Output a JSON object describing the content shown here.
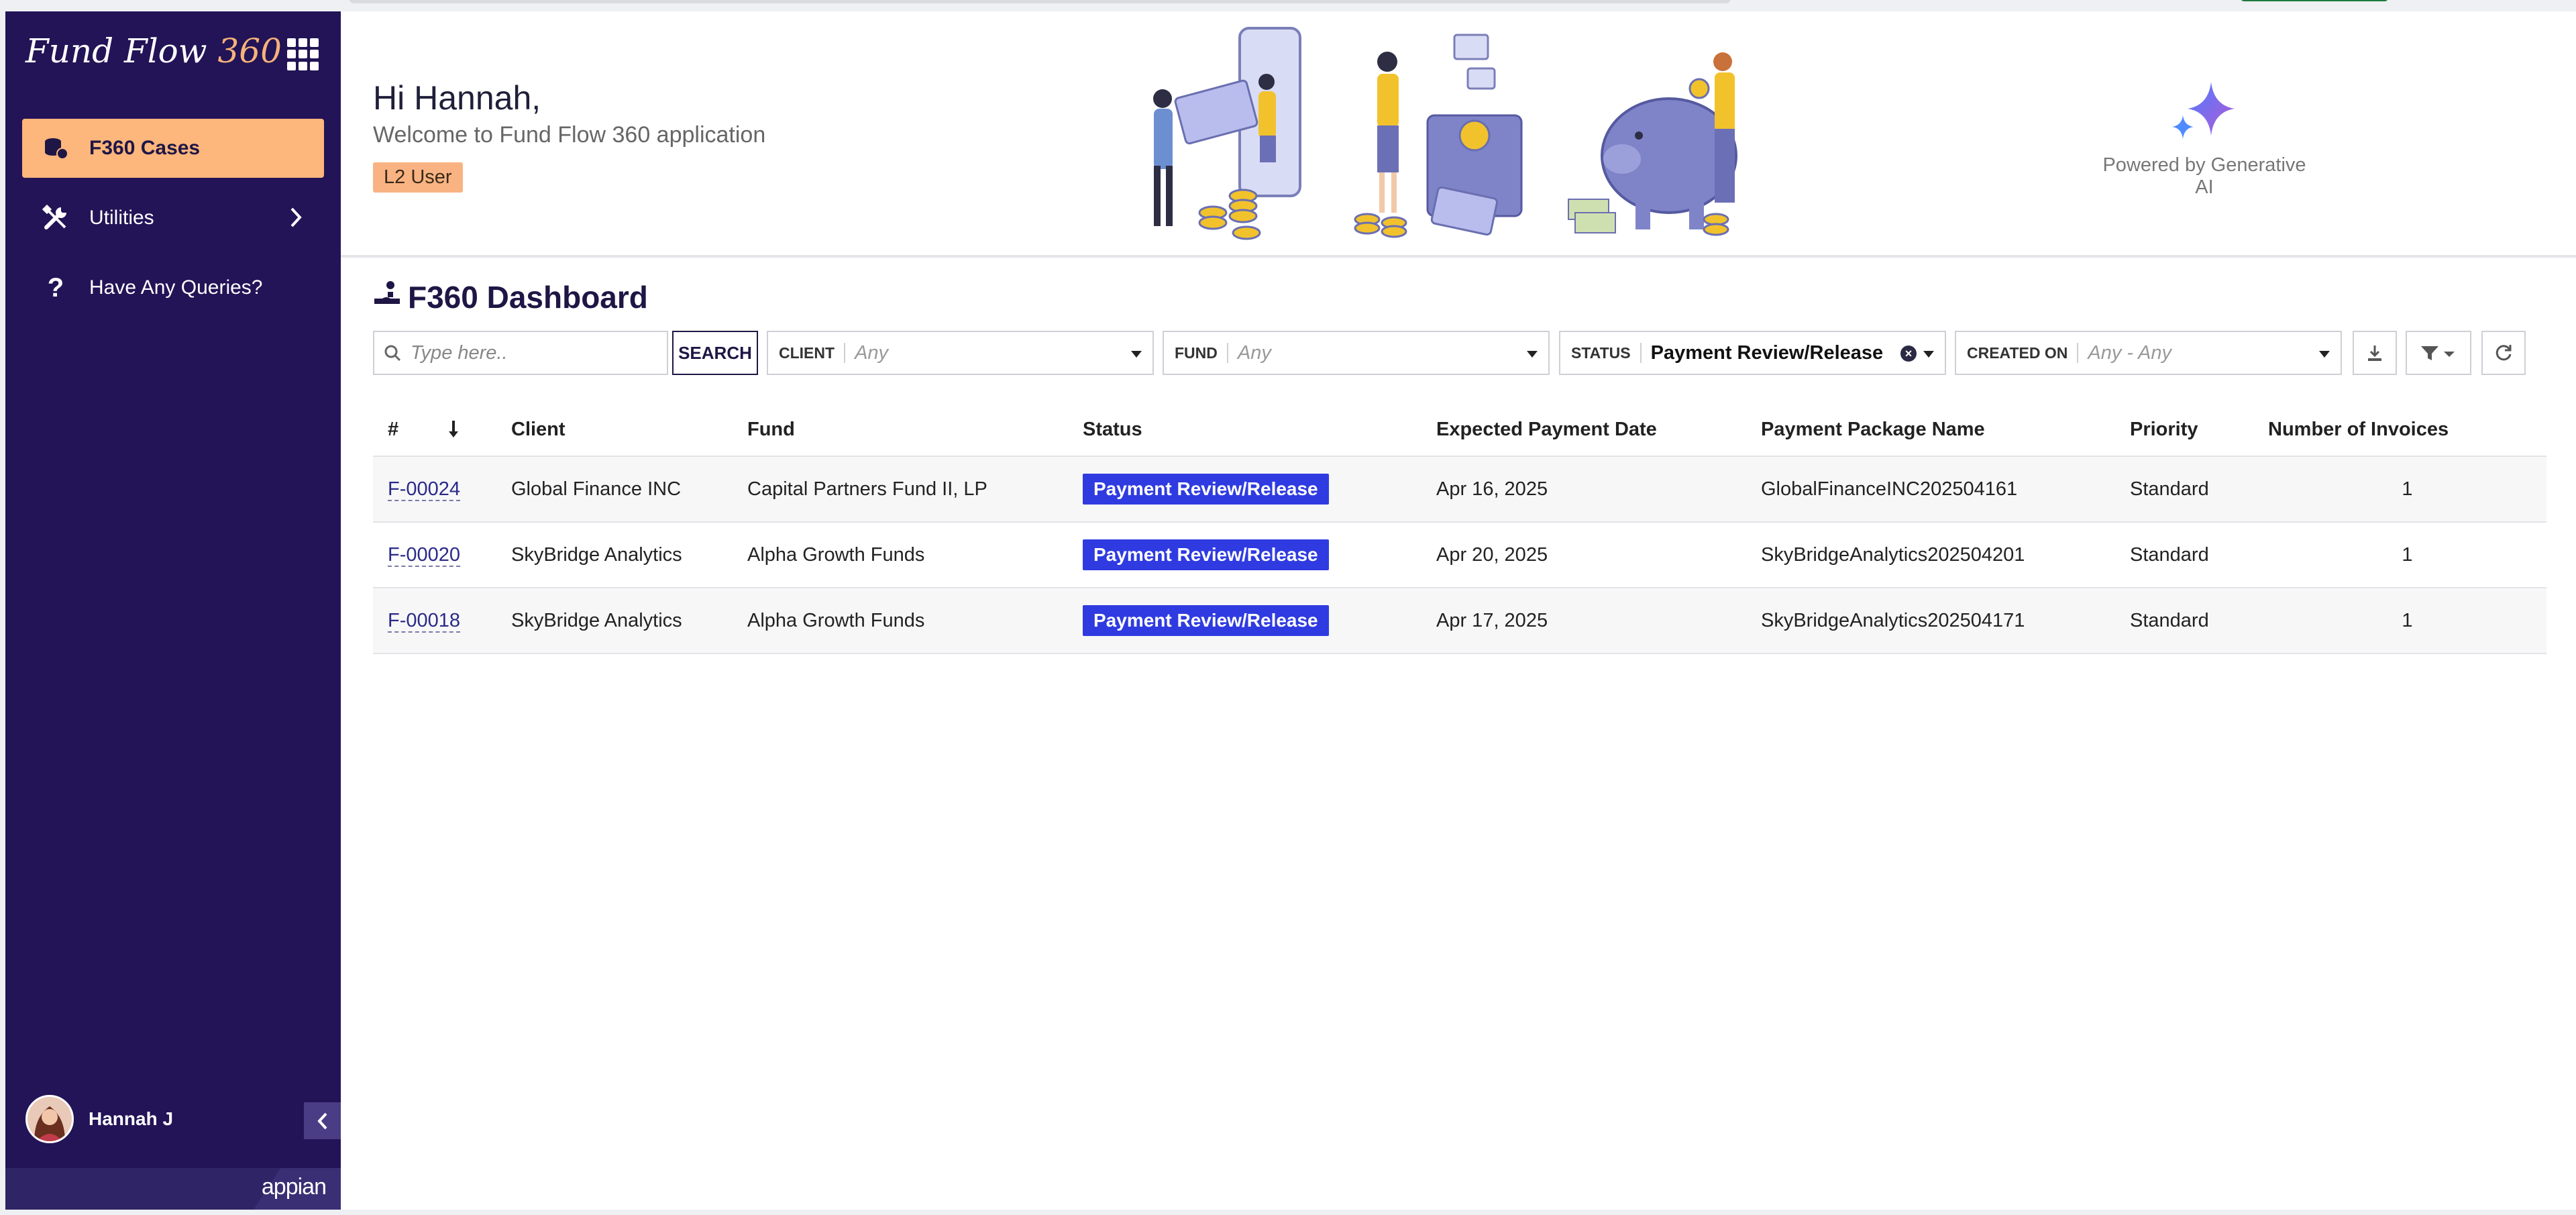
{
  "sidebar": {
    "brand_text": "Fund Flow",
    "brand_num": "360",
    "items": [
      {
        "label": "F360 Cases",
        "icon": "coins-stack-icon",
        "active": true
      },
      {
        "label": "Utilities",
        "icon": "tools-icon",
        "active": false
      },
      {
        "label": "Have Any Queries?",
        "icon": "question-icon",
        "active": false
      }
    ],
    "user_name": "Hannah J",
    "footer_brand": "appian"
  },
  "banner": {
    "greeting": "Hi Hannah,",
    "welcome": "Welcome to Fund Flow 360 application",
    "role": "L2 User",
    "powered_by": "Powered by Generative AI"
  },
  "dashboard": {
    "title": "F360 Dashboard",
    "search": {
      "placeholder": "Type here..",
      "button": "SEARCH"
    },
    "filters": {
      "client": {
        "label": "CLIENT",
        "value": "Any"
      },
      "fund": {
        "label": "FUND",
        "value": "Any"
      },
      "status": {
        "label": "STATUS",
        "value": "Payment Review/Release"
      },
      "created_on": {
        "label": "CREATED ON",
        "value": "Any - Any"
      }
    },
    "columns": [
      "#",
      "Client",
      "Fund",
      "Status",
      "Expected Payment Date",
      "Payment Package Name",
      "Priority",
      "Number of Invoices"
    ],
    "rows": [
      {
        "id": "F-00024",
        "client": "Global Finance INC",
        "fund": "Capital Partners Fund II, LP",
        "status": "Payment Review/Release",
        "date": "Apr 16, 2025",
        "package": "GlobalFinanceINC202504161",
        "priority": "Standard",
        "invoices": "1"
      },
      {
        "id": "F-00020",
        "client": "SkyBridge Analytics",
        "fund": "Alpha Growth Funds",
        "status": "Payment Review/Release",
        "date": "Apr 20, 2025",
        "package": "SkyBridgeAnalytics202504201",
        "priority": "Standard",
        "invoices": "1"
      },
      {
        "id": "F-00018",
        "client": "SkyBridge Analytics",
        "fund": "Alpha Growth Funds",
        "status": "Payment Review/Release",
        "date": "Apr 17, 2025",
        "package": "SkyBridgeAnalytics202504171",
        "priority": "Standard",
        "invoices": "1"
      }
    ]
  },
  "colors": {
    "sidebar": "#221456",
    "active_nav": "#fdb67c",
    "status_pill": "#2f3be0",
    "role_badge": "#f9b382"
  }
}
